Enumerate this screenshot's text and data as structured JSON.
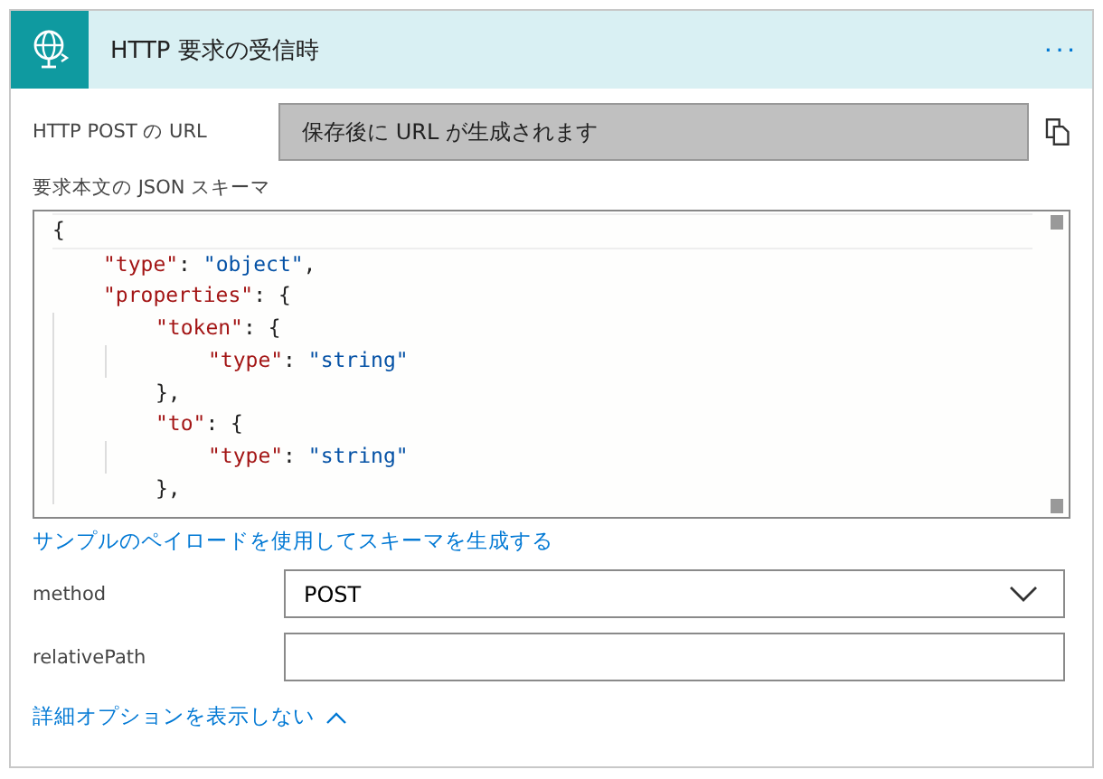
{
  "header": {
    "title": "HTTP 要求の受信時",
    "menu": "···"
  },
  "url_row": {
    "label": "HTTP POST の URL",
    "value": "保存後に URL が生成されます"
  },
  "schema": {
    "label": "要求本文の JSON スキーマ",
    "lines": [
      {
        "tokens": [
          {
            "kind": "punct",
            "text": "{"
          }
        ],
        "children": [
          {
            "tokens": [
              {
                "kind": "key",
                "text": "\"type\""
              },
              {
                "kind": "punct",
                "text": ": "
              },
              {
                "kind": "string",
                "text": "\"object\""
              },
              {
                "kind": "punct",
                "text": ","
              }
            ]
          },
          {
            "tokens": [
              {
                "kind": "key",
                "text": "\"properties\""
              },
              {
                "kind": "punct",
                "text": ": {"
              }
            ],
            "children": [
              {
                "tokens": [
                  {
                    "kind": "key",
                    "text": "\"token\""
                  },
                  {
                    "kind": "punct",
                    "text": ": {"
                  }
                ],
                "children": [
                  {
                    "tokens": [
                      {
                        "kind": "key",
                        "text": "\"type\""
                      },
                      {
                        "kind": "punct",
                        "text": ": "
                      },
                      {
                        "kind": "string",
                        "text": "\"string\""
                      }
                    ]
                  }
                ]
              },
              {
                "tokens": [
                  {
                    "kind": "punct",
                    "text": "},"
                  }
                ]
              },
              {
                "tokens": [
                  {
                    "kind": "key",
                    "text": "\"to\""
                  },
                  {
                    "kind": "punct",
                    "text": ": {"
                  }
                ],
                "children": [
                  {
                    "tokens": [
                      {
                        "kind": "key",
                        "text": "\"type\""
                      },
                      {
                        "kind": "punct",
                        "text": ": "
                      },
                      {
                        "kind": "string",
                        "text": "\"string\""
                      }
                    ]
                  }
                ]
              },
              {
                "tokens": [
                  {
                    "kind": "punct",
                    "text": "},"
                  }
                ]
              }
            ]
          }
        ]
      }
    ]
  },
  "generate_link": "サンプルのペイロードを使用してスキーマを生成する",
  "fields": [
    {
      "kind": "select",
      "label": "method",
      "value": "POST"
    },
    {
      "kind": "text",
      "label": "relativePath"
    }
  ],
  "options_link": {
    "text": "詳細オプションを表示しない",
    "expanded": true
  }
}
